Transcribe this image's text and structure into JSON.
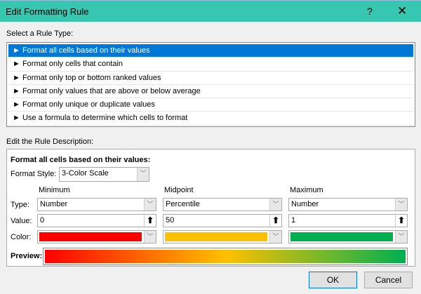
{
  "title": "Edit Formatting Rule",
  "help": "?",
  "close": "✕",
  "select_label": "Select a Rule Type:",
  "rule_types": [
    "Format all cells based on their values",
    "Format only cells that contain",
    "Format only top or bottom ranked values",
    "Format only values that are above or below average",
    "Format only unique or duplicate values",
    "Use a formula to determine which cells to format"
  ],
  "desc_label": "Edit the Rule Description:",
  "desc_heading": "Format all cells based on their values:",
  "format_style_label": "Format Style:",
  "format_style": "3-Color Scale",
  "row_labels": {
    "type": "Type:",
    "value": "Value:",
    "color": "Color:"
  },
  "columns": [
    {
      "header": "Minimum",
      "type": "Number",
      "value": "0",
      "color": "#ff0000"
    },
    {
      "header": "Midpoint",
      "type": "Percentile",
      "value": "50",
      "color": "#ffc000"
    },
    {
      "header": "Maximum",
      "type": "Number",
      "value": "1",
      "color": "#00b050"
    }
  ],
  "preview_label": "Preview:",
  "ok": "OK",
  "cancel": "Cancel"
}
